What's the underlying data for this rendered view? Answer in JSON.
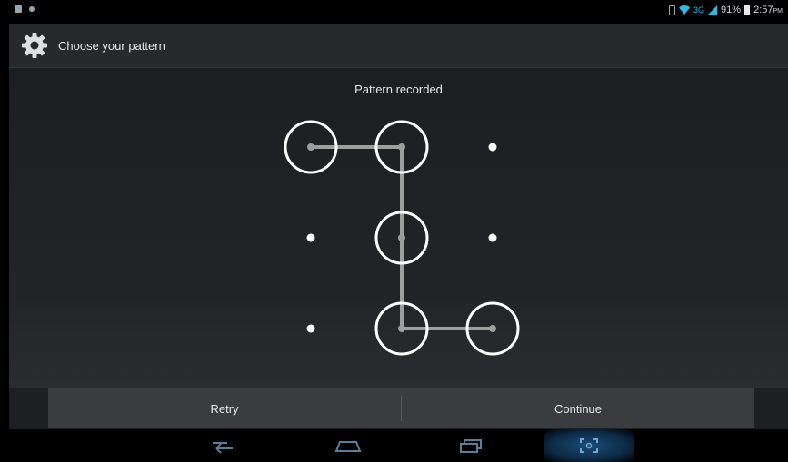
{
  "status_bar": {
    "network_type": "3G",
    "battery_percent": "91%",
    "time": "2:57",
    "time_suffix": "PM"
  },
  "action_bar": {
    "title": "Choose your pattern",
    "icon": "settings-gear-icon"
  },
  "content": {
    "header_text": "Pattern recorded",
    "pattern": {
      "grid_size": 3,
      "sequence": [
        1,
        2,
        5,
        8,
        9
      ],
      "selected_cells": [
        1,
        2,
        5,
        8,
        9
      ]
    }
  },
  "buttons": {
    "retry_label": "Retry",
    "continue_label": "Continue"
  },
  "nav_bar": {
    "items": [
      "back-icon",
      "home-icon",
      "recents-icon",
      "screenshot-icon"
    ]
  },
  "colors": {
    "accent": "#33b5e5",
    "pattern_line": "#9e9e9e",
    "circle": "#ffffff"
  }
}
